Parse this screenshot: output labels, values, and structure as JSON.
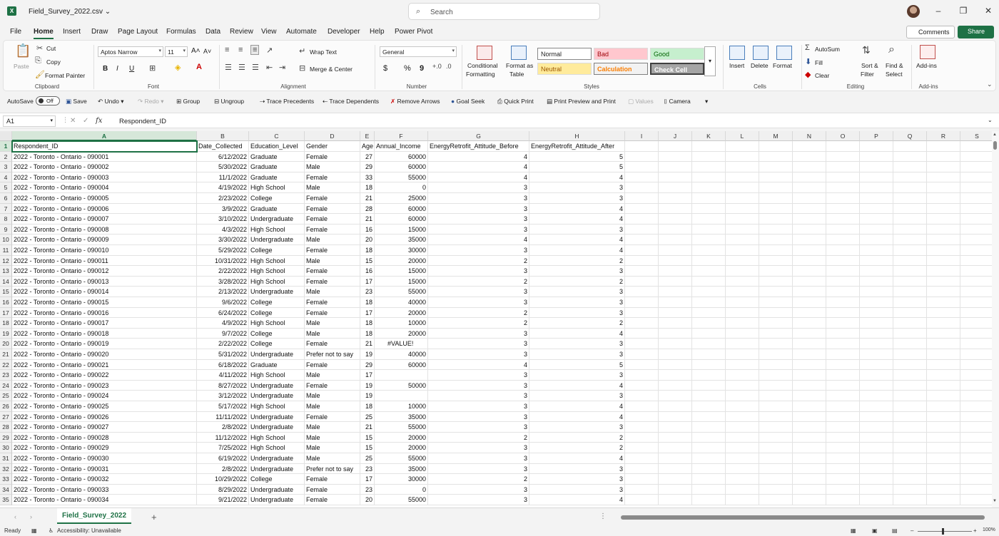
{
  "window": {
    "file_title": "Field_Survey_2022.csv",
    "app_glyph": "X",
    "search_placeholder": "Search",
    "minimize": "–",
    "restore": "❐",
    "close": "✕"
  },
  "menu": {
    "tabs": [
      "File",
      "Home",
      "Insert",
      "Draw",
      "Page Layout",
      "Formulas",
      "Data",
      "Review",
      "View",
      "Automate",
      "Developer",
      "Help",
      "Power Pivot"
    ],
    "active": "Home",
    "comments_label": "Comments",
    "share_label": "Share"
  },
  "ribbon": {
    "clipboard": {
      "paste": "Paste",
      "cut": "Cut",
      "copy": "Copy",
      "format_painter": "Format Painter",
      "group": "Clipboard"
    },
    "font": {
      "name": "Aptos Narrow",
      "size": "11",
      "bold": "B",
      "italic": "I",
      "underline": "U",
      "group": "Font"
    },
    "alignment": {
      "wrap_text": "Wrap Text",
      "merge_center": "Merge & Center",
      "group": "Alignment"
    },
    "number": {
      "format": "General",
      "currency": "$",
      "percent": "%",
      "comma": "9",
      "group": "Number"
    },
    "styles": {
      "conditional_formatting_1": "Conditional",
      "conditional_formatting_2": "Formatting",
      "format_as_table_1": "Format as",
      "format_as_table_2": "Table",
      "normal": "Normal",
      "bad": "Bad",
      "good": "Good",
      "neutral": "Neutral",
      "calculation": "Calculation",
      "check_cell": "Check Cell",
      "group": "Styles"
    },
    "cells": {
      "insert": "Insert",
      "delete": "Delete",
      "format": "Format",
      "group": "Cells"
    },
    "editing": {
      "autosum": "AutoSum",
      "fill": "Fill",
      "clear": "Clear",
      "sort_filter_1": "Sort &",
      "sort_filter_2": "Filter",
      "find_select_1": "Find &",
      "find_select_2": "Select",
      "group": "Editing"
    },
    "addins": {
      "label": "Add-ins",
      "group": "Add-ins"
    }
  },
  "qat": {
    "autosave": "AutoSave",
    "autosave_state": "Off",
    "save": "Save",
    "undo": "Undo",
    "redo": "Redo",
    "group": "Group",
    "ungroup": "Ungroup",
    "trace_precedents": "Trace Precedents",
    "trace_dependents": "Trace Dependents",
    "remove_arrows": "Remove Arrows",
    "goal_seek": "Goal Seek",
    "quick_print": "Quick Print",
    "print_preview": "Print Preview and Print",
    "values": "Values",
    "camera": "Camera"
  },
  "formula_bar": {
    "name_box": "A1",
    "fx": "fx",
    "content": "Respondent_ID"
  },
  "grid": {
    "columns": [
      "A",
      "B",
      "C",
      "D",
      "E",
      "F",
      "G",
      "H",
      "I",
      "J",
      "K",
      "L",
      "M",
      "N",
      "O",
      "P",
      "Q",
      "R",
      "S"
    ],
    "header_row": [
      "Respondent_ID",
      "Date_Collected",
      "Education_Level",
      "Gender",
      "Age",
      "Annual_Income",
      "EnergyRetrofit_Attitude_Before",
      "EnergyRetrofit_Attitude_After"
    ],
    "rows": [
      [
        "2022 - Toronto - Ontario - 090001",
        "6/12/2022",
        "Graduate",
        "Female",
        "27",
        "60000",
        "4",
        "5"
      ],
      [
        "2022 - Toronto - Ontario - 090002",
        "5/30/2022",
        "Graduate",
        "Male",
        "29",
        "60000",
        "4",
        "5"
      ],
      [
        "2022 - Toronto - Ontario - 090003",
        "11/1/2022",
        "Graduate",
        "Female",
        "33",
        "55000",
        "4",
        "4"
      ],
      [
        "2022 - Toronto - Ontario - 090004",
        "4/19/2022",
        "High School",
        "Male",
        "18",
        "0",
        "3",
        "3"
      ],
      [
        "2022 - Toronto - Ontario - 090005",
        "2/23/2022",
        "College",
        "Female",
        "21",
        "25000",
        "3",
        "3"
      ],
      [
        "2022 - Toronto - Ontario - 090006",
        "3/9/2022",
        "Graduate",
        "Female",
        "28",
        "60000",
        "3",
        "4"
      ],
      [
        "2022 - Toronto - Ontario - 090007",
        "3/10/2022",
        "Undergraduate",
        "Female",
        "21",
        "60000",
        "3",
        "4"
      ],
      [
        "2022 - Toronto - Ontario - 090008",
        "4/3/2022",
        "High School",
        "Female",
        "16",
        "15000",
        "3",
        "3"
      ],
      [
        "2022 - Toronto - Ontario - 090009",
        "3/30/2022",
        "Undergraduate",
        "Male",
        "20",
        "35000",
        "4",
        "4"
      ],
      [
        "2022 - Toronto - Ontario - 090010",
        "5/29/2022",
        "College",
        "Female",
        "18",
        "30000",
        "3",
        "4"
      ],
      [
        "2022 - Toronto - Ontario - 090011",
        "10/31/2022",
        "High School",
        "Male",
        "15",
        "20000",
        "2",
        "2"
      ],
      [
        "2022 - Toronto - Ontario - 090012",
        "2/22/2022",
        "High School",
        "Female",
        "16",
        "15000",
        "3",
        "3"
      ],
      [
        "2022 - Toronto - Ontario - 090013",
        "3/28/2022",
        "High School",
        "Female",
        "17",
        "15000",
        "2",
        "2"
      ],
      [
        "2022 - Toronto - Ontario - 090014",
        "2/13/2022",
        "Undergraduate",
        "Male",
        "23",
        "55000",
        "3",
        "3"
      ],
      [
        "2022 - Toronto - Ontario - 090015",
        "9/6/2022",
        "College",
        "Female",
        "18",
        "40000",
        "3",
        "3"
      ],
      [
        "2022 - Toronto - Ontario - 090016",
        "6/24/2022",
        "College",
        "Female",
        "17",
        "20000",
        "2",
        "3"
      ],
      [
        "2022 - Toronto - Ontario - 090017",
        "4/9/2022",
        "High School",
        "Male",
        "18",
        "10000",
        "2",
        "2"
      ],
      [
        "2022 - Toronto - Ontario - 090018",
        "9/7/2022",
        "College",
        "Male",
        "18",
        "20000",
        "3",
        "4"
      ],
      [
        "2022 - Toronto - Ontario - 090019",
        "2/22/2022",
        "College",
        "Female",
        "21",
        "#VALUE!",
        "3",
        "3"
      ],
      [
        "2022 - Toronto - Ontario - 090020",
        "5/31/2022",
        "Undergraduate",
        "Prefer not to say",
        "19",
        "40000",
        "3",
        "3"
      ],
      [
        "2022 - Toronto - Ontario - 090021",
        "6/18/2022",
        "Graduate",
        "Female",
        "29",
        "60000",
        "4",
        "5"
      ],
      [
        "2022 - Toronto - Ontario - 090022",
        "4/11/2022",
        "High School",
        "Male",
        "17",
        "",
        "3",
        "3"
      ],
      [
        "2022 - Toronto - Ontario - 090023",
        "8/27/2022",
        "Undergraduate",
        "Female",
        "19",
        "50000",
        "3",
        "4"
      ],
      [
        "2022 - Toronto - Ontario - 090024",
        "3/12/2022",
        "Undergraduate",
        "Male",
        "19",
        "",
        "3",
        "3"
      ],
      [
        "2022 - Toronto - Ontario - 090025",
        "5/17/2022",
        "High School",
        "Male",
        "18",
        "10000",
        "3",
        "4"
      ],
      [
        "2022 - Toronto - Ontario - 090026",
        "11/11/2022",
        "Undergraduate",
        "Female",
        "25",
        "35000",
        "3",
        "4"
      ],
      [
        "2022 - Toronto - Ontario - 090027",
        "2/8/2022",
        "Undergraduate",
        "Male",
        "21",
        "55000",
        "3",
        "3"
      ],
      [
        "2022 - Toronto - Ontario - 090028",
        "11/12/2022",
        "High School",
        "Male",
        "15",
        "20000",
        "2",
        "2"
      ],
      [
        "2022 - Toronto - Ontario - 090029",
        "7/25/2022",
        "High School",
        "Male",
        "15",
        "20000",
        "3",
        "2"
      ],
      [
        "2022 - Toronto - Ontario - 090030",
        "6/19/2022",
        "Undergraduate",
        "Male",
        "25",
        "55000",
        "3",
        "4"
      ],
      [
        "2022 - Toronto - Ontario - 090031",
        "2/8/2022",
        "Undergraduate",
        "Prefer not to say",
        "23",
        "35000",
        "3",
        "3"
      ],
      [
        "2022 - Toronto - Ontario - 090032",
        "10/29/2022",
        "College",
        "Female",
        "17",
        "30000",
        "2",
        "3"
      ],
      [
        "2022 - Toronto - Ontario - 090033",
        "8/29/2022",
        "Undergraduate",
        "Female",
        "23",
        "0",
        "3",
        "3"
      ],
      [
        "2022 - Toronto - Ontario - 090034",
        "9/21/2022",
        "Undergraduate",
        "Female",
        "20",
        "55000",
        "3",
        "4"
      ]
    ]
  },
  "sheets": {
    "active": "Field_Survey_2022",
    "add": "+"
  },
  "status": {
    "ready": "Ready",
    "accessibility": "Accessibility: Unavailable",
    "zoom": "100%"
  },
  "colors": {
    "accent": "#1e7145"
  }
}
